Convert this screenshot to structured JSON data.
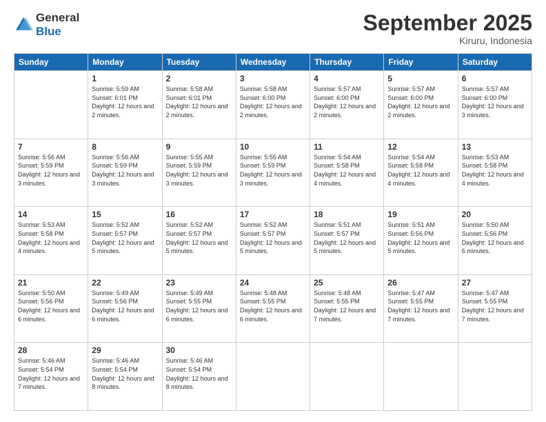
{
  "logo": {
    "text1": "General",
    "text2": "Blue"
  },
  "title": "September 2025",
  "subtitle": "Kiruru, Indonesia",
  "days_of_week": [
    "Sunday",
    "Monday",
    "Tuesday",
    "Wednesday",
    "Thursday",
    "Friday",
    "Saturday"
  ],
  "weeks": [
    [
      null,
      {
        "num": "1",
        "sunrise": "5:59 AM",
        "sunset": "6:01 PM",
        "daylight": "12 hours and 2 minutes."
      },
      {
        "num": "2",
        "sunrise": "5:58 AM",
        "sunset": "6:01 PM",
        "daylight": "12 hours and 2 minutes."
      },
      {
        "num": "3",
        "sunrise": "5:58 AM",
        "sunset": "6:00 PM",
        "daylight": "12 hours and 2 minutes."
      },
      {
        "num": "4",
        "sunrise": "5:57 AM",
        "sunset": "6:00 PM",
        "daylight": "12 hours and 2 minutes."
      },
      {
        "num": "5",
        "sunrise": "5:57 AM",
        "sunset": "6:00 PM",
        "daylight": "12 hours and 2 minutes."
      },
      {
        "num": "6",
        "sunrise": "5:57 AM",
        "sunset": "6:00 PM",
        "daylight": "12 hours and 3 minutes."
      }
    ],
    [
      {
        "num": "7",
        "sunrise": "5:56 AM",
        "sunset": "5:59 PM",
        "daylight": "12 hours and 3 minutes."
      },
      {
        "num": "8",
        "sunrise": "5:56 AM",
        "sunset": "5:59 PM",
        "daylight": "12 hours and 3 minutes."
      },
      {
        "num": "9",
        "sunrise": "5:55 AM",
        "sunset": "5:59 PM",
        "daylight": "12 hours and 3 minutes."
      },
      {
        "num": "10",
        "sunrise": "5:55 AM",
        "sunset": "5:59 PM",
        "daylight": "12 hours and 3 minutes."
      },
      {
        "num": "11",
        "sunrise": "5:54 AM",
        "sunset": "5:58 PM",
        "daylight": "12 hours and 4 minutes."
      },
      {
        "num": "12",
        "sunrise": "5:54 AM",
        "sunset": "5:58 PM",
        "daylight": "12 hours and 4 minutes."
      },
      {
        "num": "13",
        "sunrise": "5:53 AM",
        "sunset": "5:58 PM",
        "daylight": "12 hours and 4 minutes."
      }
    ],
    [
      {
        "num": "14",
        "sunrise": "5:53 AM",
        "sunset": "5:58 PM",
        "daylight": "12 hours and 4 minutes."
      },
      {
        "num": "15",
        "sunrise": "5:52 AM",
        "sunset": "5:57 PM",
        "daylight": "12 hours and 5 minutes."
      },
      {
        "num": "16",
        "sunrise": "5:52 AM",
        "sunset": "5:57 PM",
        "daylight": "12 hours and 5 minutes."
      },
      {
        "num": "17",
        "sunrise": "5:52 AM",
        "sunset": "5:57 PM",
        "daylight": "12 hours and 5 minutes."
      },
      {
        "num": "18",
        "sunrise": "5:51 AM",
        "sunset": "5:57 PM",
        "daylight": "12 hours and 5 minutes."
      },
      {
        "num": "19",
        "sunrise": "5:51 AM",
        "sunset": "5:56 PM",
        "daylight": "12 hours and 5 minutes."
      },
      {
        "num": "20",
        "sunrise": "5:50 AM",
        "sunset": "5:56 PM",
        "daylight": "12 hours and 6 minutes."
      }
    ],
    [
      {
        "num": "21",
        "sunrise": "5:50 AM",
        "sunset": "5:56 PM",
        "daylight": "12 hours and 6 minutes."
      },
      {
        "num": "22",
        "sunrise": "5:49 AM",
        "sunset": "5:56 PM",
        "daylight": "12 hours and 6 minutes."
      },
      {
        "num": "23",
        "sunrise": "5:49 AM",
        "sunset": "5:55 PM",
        "daylight": "12 hours and 6 minutes."
      },
      {
        "num": "24",
        "sunrise": "5:48 AM",
        "sunset": "5:55 PM",
        "daylight": "12 hours and 6 minutes."
      },
      {
        "num": "25",
        "sunrise": "5:48 AM",
        "sunset": "5:55 PM",
        "daylight": "12 hours and 7 minutes."
      },
      {
        "num": "26",
        "sunrise": "5:47 AM",
        "sunset": "5:55 PM",
        "daylight": "12 hours and 7 minutes."
      },
      {
        "num": "27",
        "sunrise": "5:47 AM",
        "sunset": "5:55 PM",
        "daylight": "12 hours and 7 minutes."
      }
    ],
    [
      {
        "num": "28",
        "sunrise": "5:46 AM",
        "sunset": "5:54 PM",
        "daylight": "12 hours and 7 minutes."
      },
      {
        "num": "29",
        "sunrise": "5:46 AM",
        "sunset": "5:54 PM",
        "daylight": "12 hours and 8 minutes."
      },
      {
        "num": "30",
        "sunrise": "5:46 AM",
        "sunset": "5:54 PM",
        "daylight": "12 hours and 8 minutes."
      },
      null,
      null,
      null,
      null
    ]
  ]
}
